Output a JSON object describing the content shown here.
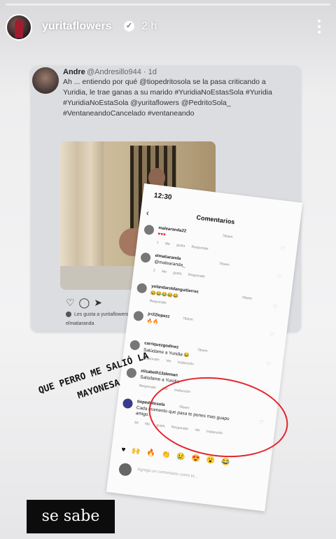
{
  "story": {
    "username": "yuritaflowers",
    "time": "2 h",
    "progress_fraction": 0.0
  },
  "tweet": {
    "name": "Andre",
    "handle": "@Andresillo944 · 1d",
    "text": "Ah ... entiendo por qué @tiopedritosola se la pasa criticando a Yuridia, le trae ganas a su marido #YuridiaNoEstasSola #Yuridia #YuridiaNoEstaSola @yuritaflowers @PedritoSola_ #VentaneandoCancelado #ventaneando",
    "likes": "Les gusta a yuritaflowers y 12,175 más",
    "comment": "elmatiaranda"
  },
  "phone": {
    "time": "12:30",
    "title": "Comentarios",
    "comments": [
      {
        "user": "malearanda22",
        "time": "78sem",
        "text": "♥♥♥",
        "meta": "1 Me gusta   Responder"
      },
      {
        "user": "elmatiaranda",
        "time": "78sem",
        "text": "@malearanda_",
        "meta": "2 Me gusta   Responder"
      },
      {
        "user": "yolandaroldanguitierrez",
        "time": "78sem",
        "text": "😂😂😂😂😂",
        "meta": "Responder"
      },
      {
        "user": "jrr22lopezz",
        "time": "78sem",
        "text": "🔥🔥",
        "meta": "Responder"
      },
      {
        "user": "carriquezgodinez",
        "time": "78sem",
        "text": "Salúdame a Yuridia 😂",
        "meta": "Responder   Ver traducción"
      },
      {
        "user": "elizabeth13aleman",
        "time": "78sem",
        "text": "Salúdame a Yuridia",
        "meta": "Responder   Ver traducción"
      },
      {
        "user": "tiopedritosola",
        "time": "78sem",
        "text": "Cada momento que pasa te pones mas guapo amigo.",
        "meta": "84 Me gusta   Responder   Ver traducción"
      }
    ],
    "emojis": "♥🙌🔥👏😢😍😮😂",
    "input_placeholder": "Agrega un comentario como ta..."
  },
  "caption": "QUE PERRO ME SALIÓ LA\nMAYONESA",
  "label": "se sabe",
  "colors": {
    "accent_red": "#e5242c",
    "link_blue": "#3b82c4",
    "label_bg": "#0c0c0c"
  }
}
